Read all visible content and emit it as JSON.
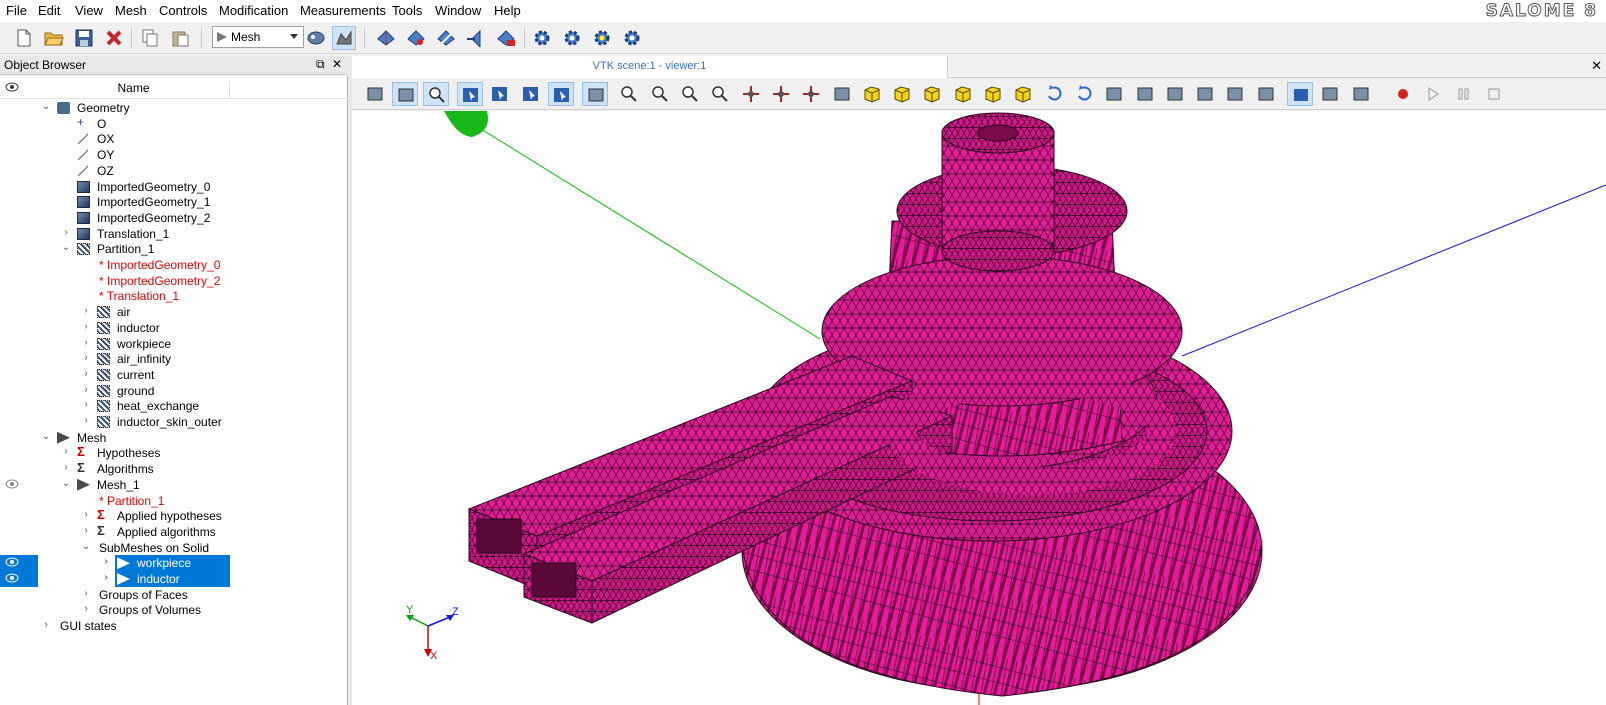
{
  "app": {
    "logo": "SALOME 8"
  },
  "menu": [
    "File",
    "Edit",
    "View",
    "Mesh",
    "Controls",
    "Modification",
    "Measurements",
    "Tools",
    "Window",
    "Help"
  ],
  "toolbar": {
    "module": "Mesh",
    "icons": [
      "new-file-icon",
      "open-file-icon",
      "save-icon",
      "close-study-icon",
      "copy-icon",
      "paste-icon",
      "mesh-module-icon",
      "geometry-module-icon",
      "create-mesh-icon",
      "create-submesh-icon",
      "edit-mesh-icon",
      "import-mesh-icon",
      "compute-mesh-icon",
      "compute-icon",
      "evaluate-icon",
      "preview-icon",
      "compute-all-icon"
    ]
  },
  "object_browser": {
    "title": "Object Browser",
    "column_name": "Name",
    "tree": [
      {
        "label": "Geometry",
        "level": 1,
        "expander": "open",
        "icon": "geometry-icon",
        "eye": false
      },
      {
        "label": "O",
        "level": 2,
        "expander": "",
        "icon": "point-icon",
        "eye": false
      },
      {
        "label": "OX",
        "level": 2,
        "expander": "",
        "icon": "vector-icon",
        "eye": false
      },
      {
        "label": "OY",
        "level": 2,
        "expander": "",
        "icon": "vector-icon",
        "eye": false
      },
      {
        "label": "OZ",
        "level": 2,
        "expander": "",
        "icon": "vector-icon",
        "eye": false
      },
      {
        "label": "ImportedGeometry_0",
        "level": 2,
        "expander": "",
        "icon": "solid-icon",
        "eye": false
      },
      {
        "label": "ImportedGeometry_1",
        "level": 2,
        "expander": "",
        "icon": "solid-icon",
        "eye": false
      },
      {
        "label": "ImportedGeometry_2",
        "level": 2,
        "expander": "",
        "icon": "solid-icon",
        "eye": false
      },
      {
        "label": "Translation_1",
        "level": 2,
        "expander": "closed",
        "icon": "solid-icon",
        "eye": false
      },
      {
        "label": "Partition_1",
        "level": 2,
        "expander": "open",
        "icon": "partition-icon",
        "eye": false
      },
      {
        "label": "* ImportedGeometry_0",
        "level": 3,
        "expander": "",
        "icon": "",
        "red": true
      },
      {
        "label": "* ImportedGeometry_2",
        "level": 3,
        "expander": "",
        "icon": "",
        "red": true
      },
      {
        "label": "* Translation_1",
        "level": 3,
        "expander": "",
        "icon": "",
        "red": true
      },
      {
        "label": "air",
        "level": 3,
        "expander": "closed",
        "icon": "group-icon"
      },
      {
        "label": "inductor",
        "level": 3,
        "expander": "closed",
        "icon": "group-icon"
      },
      {
        "label": "workpiece",
        "level": 3,
        "expander": "closed",
        "icon": "group-icon"
      },
      {
        "label": "air_infinity",
        "level": 3,
        "expander": "closed",
        "icon": "group-icon"
      },
      {
        "label": "current",
        "level": 3,
        "expander": "closed",
        "icon": "group-icon"
      },
      {
        "label": "ground",
        "level": 3,
        "expander": "closed",
        "icon": "group-icon"
      },
      {
        "label": "heat_exchange",
        "level": 3,
        "expander": "closed",
        "icon": "group-icon"
      },
      {
        "label": "inductor_skin_outer",
        "level": 3,
        "expander": "closed",
        "icon": "group-icon"
      },
      {
        "label": "Mesh",
        "level": 1,
        "expander": "open",
        "icon": "mesh-icon"
      },
      {
        "label": "Hypotheses",
        "level": 2,
        "expander": "closed",
        "icon": "hypothesis-icon"
      },
      {
        "label": "Algorithms",
        "level": 2,
        "expander": "closed",
        "icon": "algorithm-icon"
      },
      {
        "label": "Mesh_1",
        "level": 2,
        "expander": "open",
        "icon": "mesh-icon",
        "eye": true
      },
      {
        "label": "* Partition_1",
        "level": 3,
        "expander": "",
        "icon": "",
        "red": true
      },
      {
        "label": "Applied hypotheses",
        "level": 3,
        "expander": "closed",
        "icon": "hypothesis-icon"
      },
      {
        "label": "Applied algorithms",
        "level": 3,
        "expander": "closed",
        "icon": "algorithm-icon"
      },
      {
        "label": "SubMeshes on Solid",
        "level": 3,
        "expander": "open",
        "icon": ""
      },
      {
        "label": "workpiece",
        "level": 4,
        "expander": "closed",
        "icon": "mesh-icon",
        "selected": true,
        "eye": true
      },
      {
        "label": "inductor",
        "level": 4,
        "expander": "closed",
        "icon": "mesh-icon",
        "selected": true,
        "eye": true
      },
      {
        "label": "Groups of Faces",
        "level": 3,
        "expander": "closed",
        "icon": ""
      },
      {
        "label": "Groups of Volumes",
        "level": 3,
        "expander": "closed",
        "icon": ""
      },
      {
        "label": "GUI states",
        "level": 1,
        "expander": "closed",
        "icon": ""
      }
    ]
  },
  "viewer": {
    "tab_title": "VTK scene:1 - viewer:1",
    "close_glyph": "✕",
    "toolbar_icons": [
      "dump-view-icon",
      "interaction-style-icon",
      "zooming-style-icon",
      "rectangle-selection-icon",
      "polygon-selection-icon",
      "selection-mode-icon",
      "preselection-icon",
      "show-trihedron-icon",
      "fit-all-icon",
      "fit-area-icon",
      "fit-selection-icon",
      "zoom-icon",
      "pan-icon",
      "global-pan-icon",
      "rotation-point-icon",
      "rotate-icon",
      "front-view-icon",
      "back-view-icon",
      "top-view-icon",
      "bottom-view-icon",
      "left-view-icon",
      "right-view-icon",
      "rotate-counterclockwise-icon",
      "rotate-clockwise-icon",
      "reset-view-icon",
      "lod-icon",
      "clipping-icon",
      "scaling-icon",
      "graduated-axes-icon",
      "view-mode-icon",
      "perspective-icon",
      "shaded-icon",
      "stereo-icon",
      "record-icon",
      "play-icon",
      "pause-icon",
      "stop-icon"
    ],
    "axis_labels": {
      "x": "X",
      "y": "Y",
      "z": "Z"
    },
    "mesh_color": "#e81a9a"
  },
  "colors": {
    "selection": "#0078d7",
    "red_text": "#e00000"
  }
}
